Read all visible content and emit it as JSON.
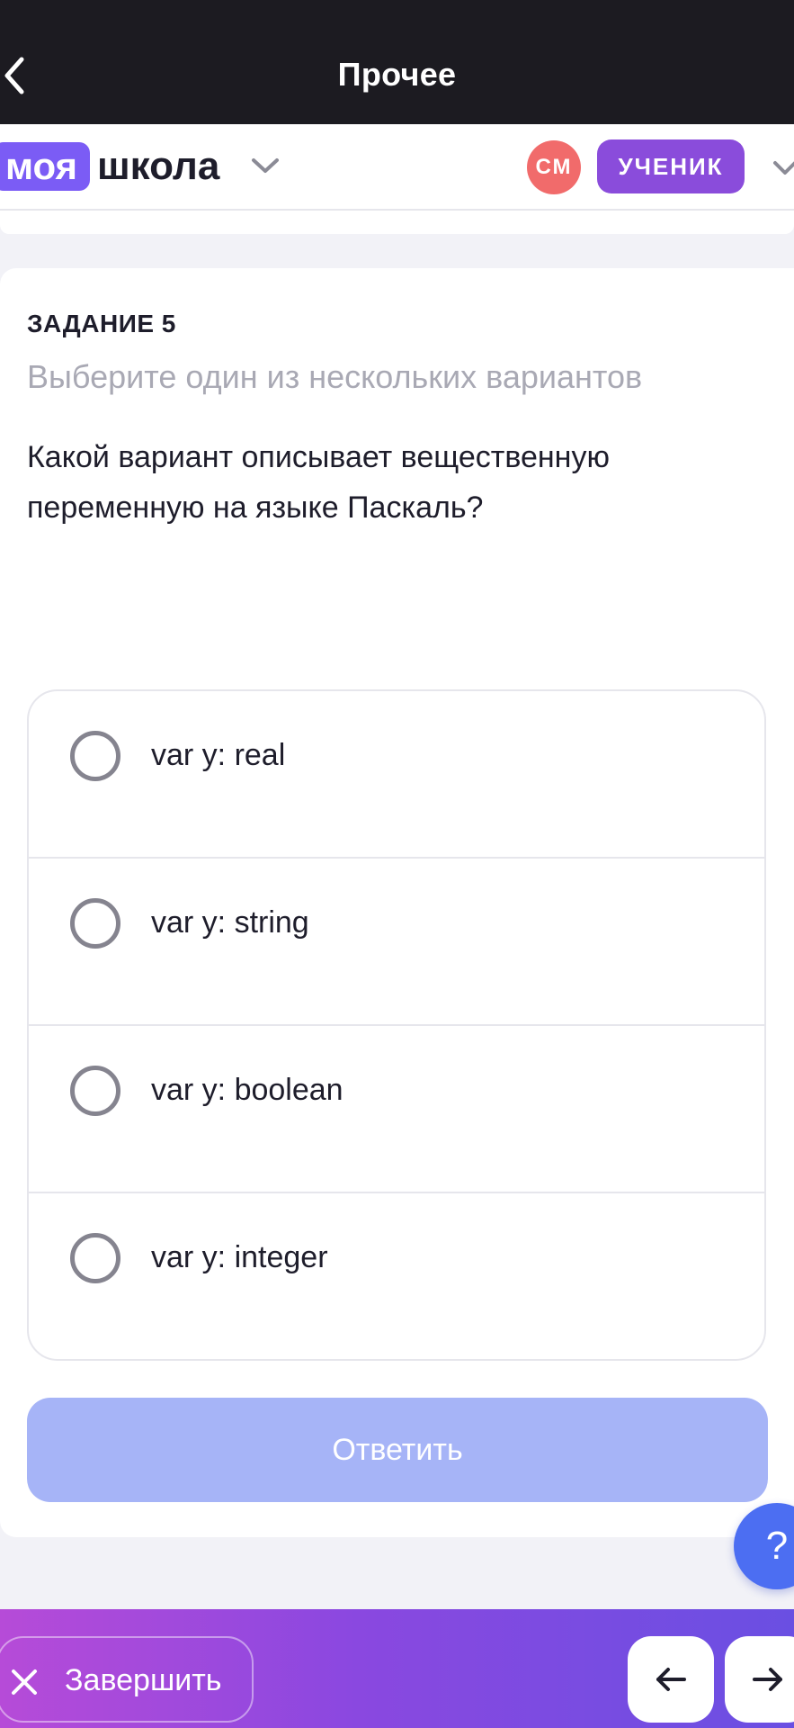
{
  "topbar": {
    "title": "Прочее"
  },
  "header": {
    "logo_highlight": "моя",
    "logo_word": "школа",
    "avatar_initials": "СМ",
    "role": "УЧЕНИК"
  },
  "task": {
    "number": "ЗАДАНИЕ 5",
    "hint": "Выберите один из нескольких вариантов",
    "question": "Какой вариант описывает вещественную переменную на языке Паскаль?"
  },
  "options": [
    {
      "label": "var y: real"
    },
    {
      "label": "var y: string"
    },
    {
      "label": "var y: boolean"
    },
    {
      "label": "var y: integer"
    }
  ],
  "answer_button": "Ответить",
  "help_button": "?",
  "bottombar": {
    "finish_label": "Завершить"
  },
  "colors": {
    "topbar_bg": "#1c1b21",
    "brand_purple": "#7b5cf5",
    "role_badge": "#8a4cdb",
    "avatar_bg": "#f16b6b",
    "answer_disabled": "#a6b4f7",
    "help_blue": "#4c6ef2"
  },
  "icons": [
    "back-icon",
    "chevron-down-icon",
    "close-icon",
    "arrow-left-icon",
    "arrow-right-icon"
  ]
}
